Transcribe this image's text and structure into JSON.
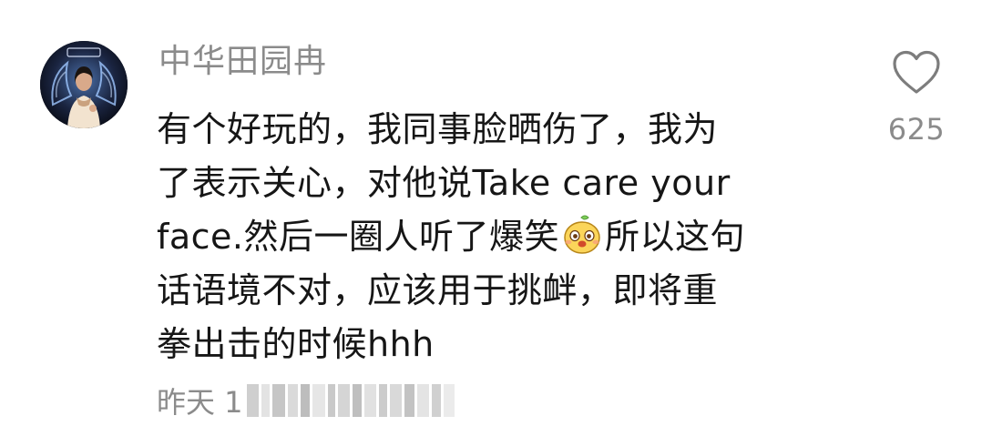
{
  "comment": {
    "username": "中华田园冉",
    "avatar_icon": "user-avatar",
    "lines": [
      "有个好玩的，我同事脸晒伤了，我为",
      "了表示关心，对他说Take care your",
      "face.然后一圈人听了爆笑",
      "所以这句",
      "话语境不对，应该用于挑衅，即将重",
      "拳出击的时候hhh"
    ],
    "emoji_icon": "laughing-sticker-emoji",
    "timestamp": "昨天 1",
    "like_icon": "heart-outline-icon",
    "like_count": "625"
  },
  "colors": {
    "text_primary": "#161616",
    "text_secondary": "#8b8b8b",
    "background": "#ffffff"
  }
}
